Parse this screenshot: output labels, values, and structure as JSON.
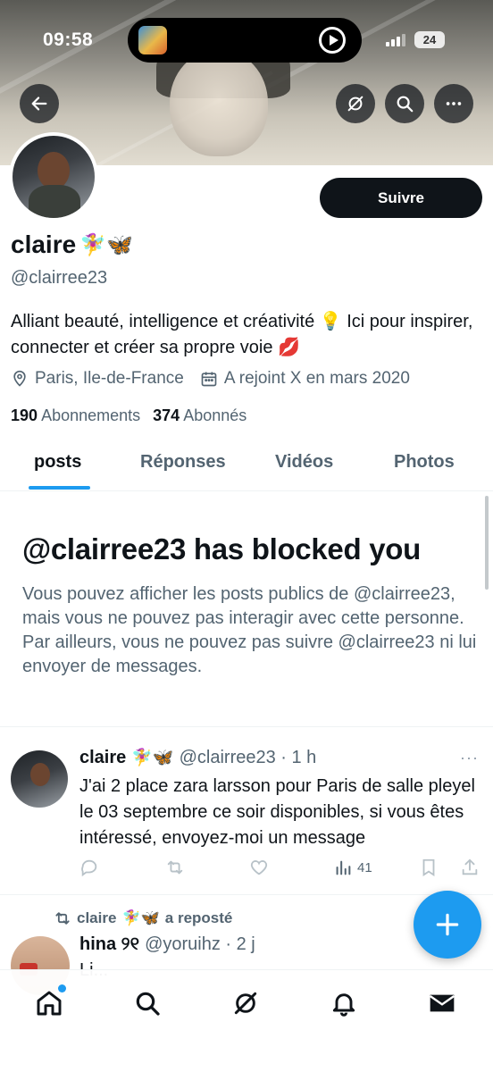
{
  "status_bar": {
    "time": "09:58",
    "battery": "24"
  },
  "profile": {
    "follow_label": "Suivre",
    "name": "claire",
    "name_emojis": "🧚‍♀️🦋",
    "handle": "@clairree23",
    "bio_text": "Alliant beauté, intelligence et créativité",
    "bio_emoji_1": "💡",
    "bio_text_2": "Ici pour inspirer, connecter et créer sa propre voie",
    "bio_emoji_2": "💋",
    "location": "Paris, Ile-de-France",
    "joined": "A rejoint X en mars 2020",
    "following_count": "190",
    "following_label": "Abonnements",
    "followers_count": "374",
    "followers_label": "Abonnés"
  },
  "tabs": [
    {
      "label": "posts",
      "active": true
    },
    {
      "label": "Réponses",
      "active": false
    },
    {
      "label": "Vidéos",
      "active": false
    },
    {
      "label": "Photos",
      "active": false
    }
  ],
  "blocked": {
    "title": "@clairree23 has blocked you",
    "description": "Vous pouvez afficher les posts publics de @clairree23, mais vous ne pouvez pas interagir avec cette personne. Par ailleurs, vous ne pouvez pas suivre @clairree23 ni lui envoyer de messages."
  },
  "tweet": {
    "name": "claire",
    "emojis": "🧚‍♀️🦋",
    "handle_time": "@clairree23 · 1 h",
    "text": "J'ai 2 place zara larsson pour Paris de salle pleyel le 03 septembre ce soir disponibles, si vous êtes intéressé, envoyez-moi un message",
    "views": "41",
    "more": "···"
  },
  "repost": {
    "label_name": "claire",
    "label_emojis": "🧚‍♀️🦋",
    "label_suffix": "a reposté",
    "name": "hina ୨୧",
    "handle_time": "@yoruihz · 2 j",
    "text_partial": "Li..."
  },
  "icons": {
    "back": "arrow-left-icon",
    "grok": "grok-icon",
    "search": "search-icon",
    "more": "more-icon",
    "location": "location-pin-icon",
    "calendar": "calendar-icon",
    "reply": "reply-icon",
    "retweet": "retweet-icon",
    "like": "heart-icon",
    "views": "views-icon",
    "bookmark": "bookmark-icon",
    "share": "share-icon",
    "compose": "plus-icon",
    "home": "home-icon",
    "notifications": "bell-icon",
    "messages": "envelope-icon"
  },
  "colors": {
    "accent": "#1d9bf0",
    "text": "#0f1419",
    "secondary": "#536471"
  }
}
